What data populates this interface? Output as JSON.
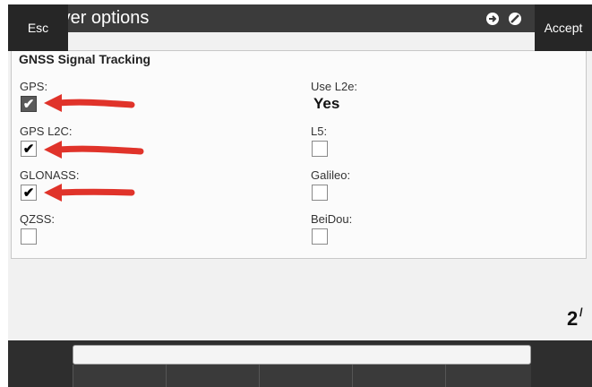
{
  "window": {
    "title": "Rover options",
    "icons": [
      "app-logo-icon",
      "navigate-icon",
      "no-entry-icon",
      "help-icon",
      "minimize-icon",
      "close-icon"
    ],
    "help_label": "?",
    "minimize_label": "–",
    "close_label": "✕"
  },
  "group": {
    "title": "GNSS Signal Tracking"
  },
  "left_fields": [
    {
      "label": "GPS:",
      "checked": true
    },
    {
      "label": "GPS L2C:",
      "checked": true
    },
    {
      "label": "GLONASS:",
      "checked": true
    },
    {
      "label": "QZSS:",
      "checked": false
    }
  ],
  "right_fields": {
    "use_l2e": {
      "label": "Use L2e:",
      "value": "Yes"
    },
    "l5": {
      "label": "L5:",
      "checked": false
    },
    "galileo": {
      "label": "Galileo:",
      "checked": false
    },
    "beidou": {
      "label": "BeiDou:",
      "checked": false
    }
  },
  "page_indicator": {
    "current": "2",
    "total_glyph": "/"
  },
  "softkeys": {
    "esc": "Esc",
    "accept": "Accept"
  },
  "annotation": {
    "arrow_color": "#e0332a"
  },
  "colors": {
    "titlebar": "#3b3b3b",
    "bottombar": "#2e2e2e"
  }
}
